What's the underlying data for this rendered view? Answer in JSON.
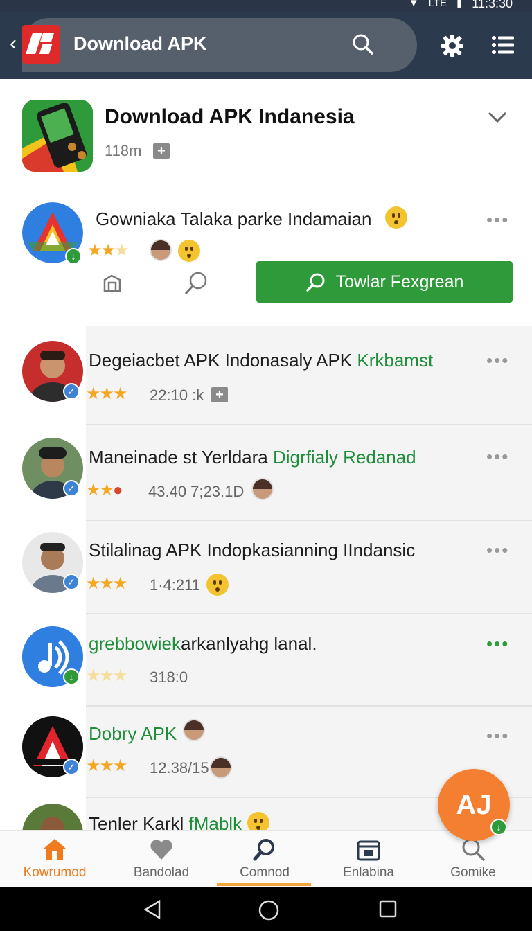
{
  "status_bar": {
    "time": "11:3:30",
    "network": "LTE"
  },
  "appbar": {
    "title": "Download APK",
    "back_icon": "back-arrow-icon"
  },
  "hero": {
    "title": "Download APK Indanesia",
    "subtitle": "118m"
  },
  "featured": {
    "title": "Gowniaka Talaka parke Indamaian",
    "rating": 2,
    "button_label": "Towlar Fexgrean"
  },
  "list": [
    {
      "title": "Degeiacbet APK Indonasaly APK ",
      "highlight": "Krkbamst",
      "rating": 3,
      "meta": "22:10 :k"
    },
    {
      "title": "Maneinade st Yerldara ",
      "highlight": "Digrfialy  Redanad",
      "rating": 2,
      "meta": "43.40 7;23.1D"
    },
    {
      "title": "Stilalinag APK Indopkasianning IIndansic",
      "highlight": "",
      "rating": 3,
      "meta": "1·4:211"
    },
    {
      "title": "arkanlyahg lanal.",
      "highlight_prefix": "grebbowiek",
      "rating": 0,
      "meta": "318:0"
    },
    {
      "title": "",
      "highlight_prefix": "Dobry APK",
      "rating": 3,
      "meta": "12.38/15"
    },
    {
      "title": "Tenler Karkl ",
      "highlight": "fMablk",
      "rating": 0,
      "meta": ""
    }
  ],
  "fab": {
    "label": "AJ"
  },
  "bottom_nav": [
    {
      "label": "Kowrumod",
      "icon": "home-icon",
      "active": true
    },
    {
      "label": "Bandolad",
      "icon": "heart-icon",
      "active": false
    },
    {
      "label": "Comnod",
      "icon": "explore-icon",
      "active": false
    },
    {
      "label": "Enlabina",
      "icon": "calendar-icon",
      "active": false
    },
    {
      "label": "Gomike",
      "icon": "search-icon",
      "active": false
    }
  ],
  "colors": {
    "appbar": "#2b3a4d",
    "accent_green": "#2e9a3a",
    "accent_orange": "#f47f30",
    "star": "#f5a623"
  }
}
